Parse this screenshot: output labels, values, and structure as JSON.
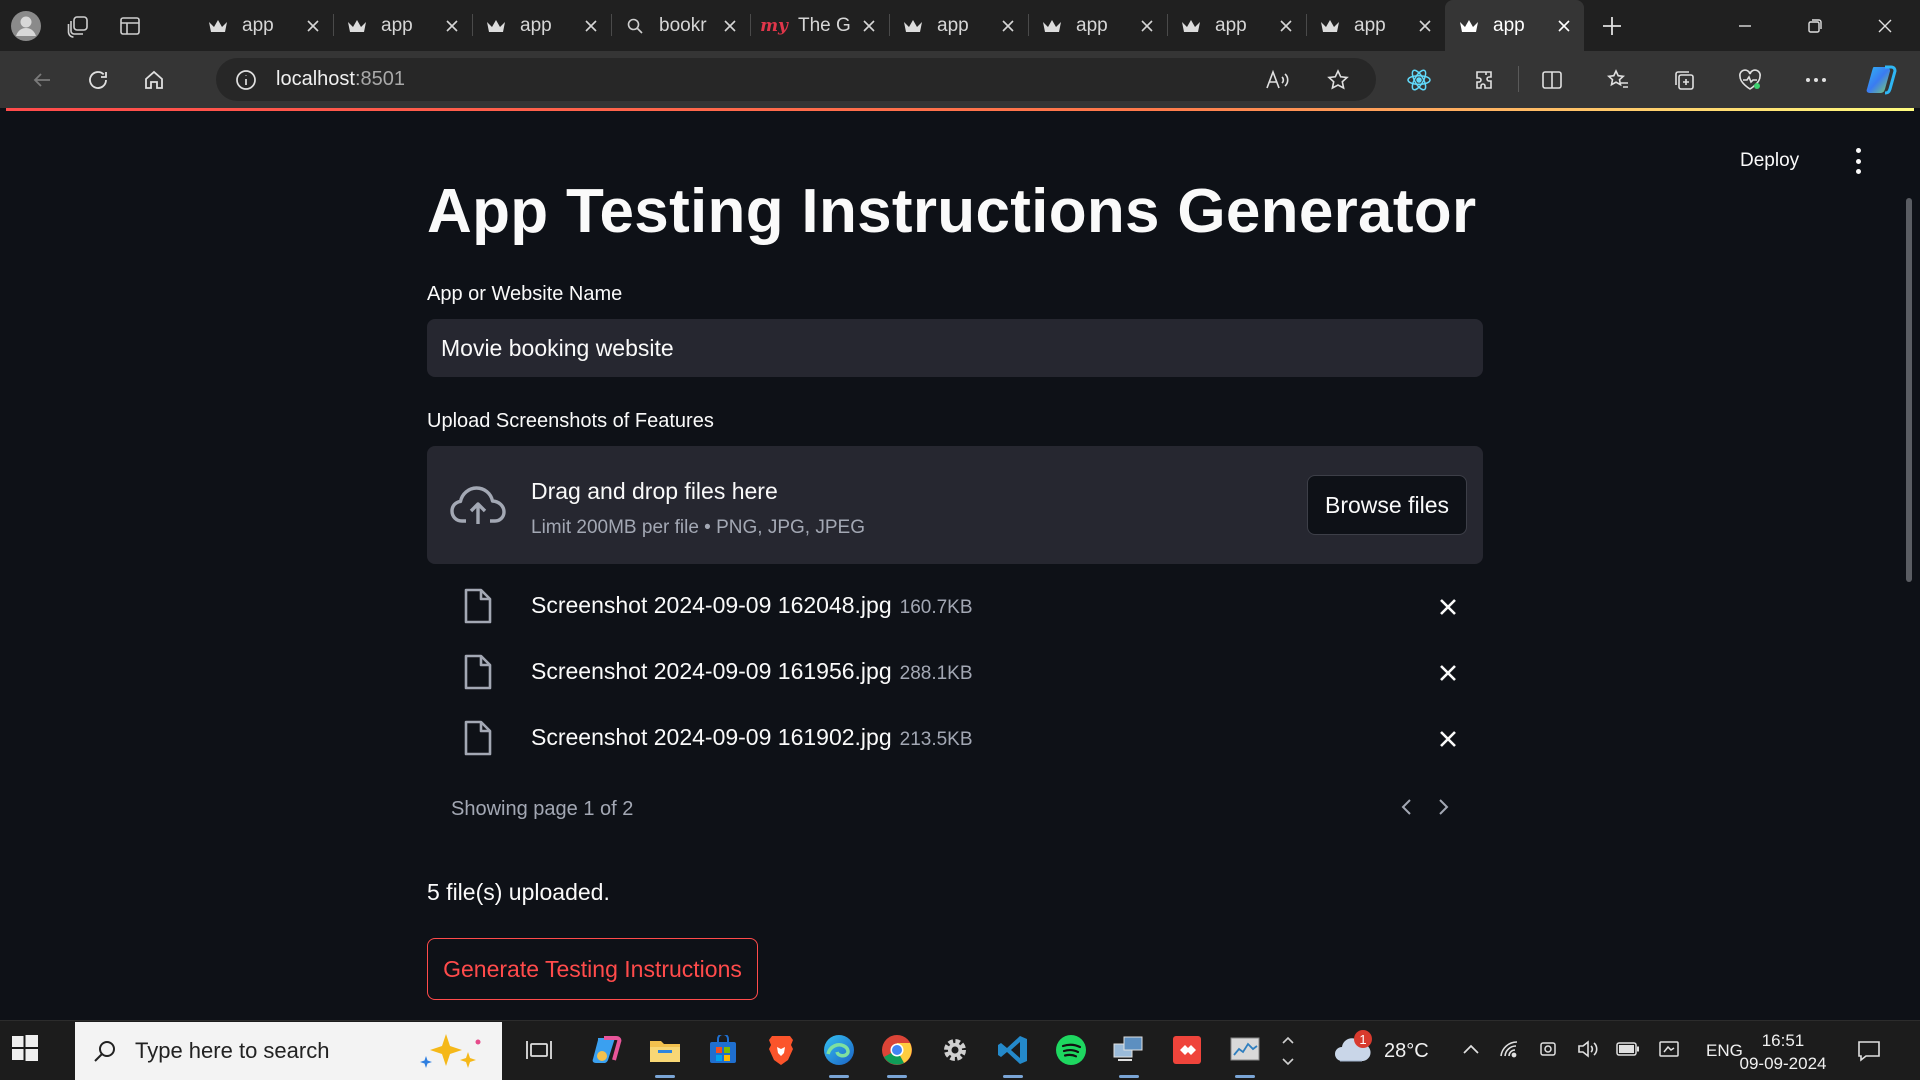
{
  "browser": {
    "tabs": [
      {
        "title": "app",
        "favicon": "streamlit-crown-icon",
        "active": false
      },
      {
        "title": "app",
        "favicon": "streamlit-crown-icon",
        "active": false
      },
      {
        "title": "app",
        "favicon": "streamlit-crown-icon",
        "active": false
      },
      {
        "title": "bookr",
        "favicon": "search-icon",
        "active": false
      },
      {
        "title": "The G",
        "favicon": "my-red-icon",
        "active": false
      },
      {
        "title": "app",
        "favicon": "streamlit-crown-icon",
        "active": false
      },
      {
        "title": "app",
        "favicon": "streamlit-crown-icon",
        "active": false
      },
      {
        "title": "app",
        "favicon": "streamlit-crown-icon",
        "active": false
      },
      {
        "title": "app",
        "favicon": "streamlit-crown-icon",
        "active": false
      },
      {
        "title": "app",
        "favicon": "streamlit-crown-icon",
        "active": true
      }
    ],
    "address": {
      "host": "localhost",
      "port": ":8501"
    }
  },
  "app": {
    "deploy_label": "Deploy",
    "title": "App Testing Instructions Generator",
    "name_label": "App or Website Name",
    "name_value": "Movie booking website",
    "upload_label": "Upload Screenshots of Features",
    "dropzone_title": "Drag and drop files here",
    "dropzone_sub": "Limit 200MB per file • PNG, JPG, JPEG",
    "browse_label": "Browse files",
    "files": [
      {
        "name": "Screenshot 2024-09-09 162048.jpg",
        "size": "160.7KB"
      },
      {
        "name": "Screenshot 2024-09-09 161956.jpg",
        "size": "288.1KB"
      },
      {
        "name": "Screenshot 2024-09-09 161902.jpg",
        "size": "213.5KB"
      }
    ],
    "pager_text": "Showing page 1 of 2",
    "status_text": "5 file(s) uploaded.",
    "generate_label": "Generate Testing Instructions"
  },
  "taskbar": {
    "search_placeholder": "Type here to search",
    "weather_badge": "1",
    "temperature": "28°C",
    "language": "ENG",
    "time": "16:51",
    "date": "09-09-2024"
  },
  "colors": {
    "accent": "#ff4b4b",
    "page_bg": "#0e1117",
    "input_bg": "#262730"
  }
}
